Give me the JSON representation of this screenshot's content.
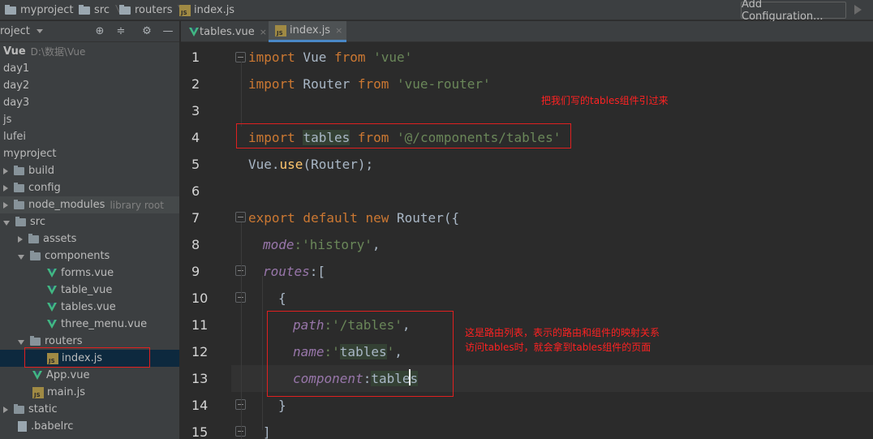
{
  "breadcrumb": {
    "items": [
      "myproject",
      "src",
      "routers",
      "index.js"
    ]
  },
  "toolbar": {
    "add_configuration": "Add Configuration..."
  },
  "project_panel": {
    "title": "roject",
    "tree": [
      {
        "label": "Vue",
        "extra": "D:\\数据\\Vue",
        "type": "root"
      },
      {
        "label": "day1",
        "type": "folder"
      },
      {
        "label": "day2",
        "type": "folder"
      },
      {
        "label": "day3",
        "type": "folder"
      },
      {
        "label": "js",
        "type": "folder"
      },
      {
        "label": "lufei",
        "type": "folder"
      },
      {
        "label": "myproject",
        "type": "folder"
      },
      {
        "label": "build",
        "type": "folder"
      },
      {
        "label": "config",
        "type": "folder"
      },
      {
        "label": "node_modules",
        "extra": "library root",
        "type": "folder"
      },
      {
        "label": "src",
        "type": "folder"
      },
      {
        "label": "assets",
        "type": "folder"
      },
      {
        "label": "components",
        "type": "folder"
      },
      {
        "label": "forms.vue",
        "type": "vue"
      },
      {
        "label": "table_vue",
        "type": "vue"
      },
      {
        "label": "tables.vue",
        "type": "vue"
      },
      {
        "label": "three_menu.vue",
        "type": "vue"
      },
      {
        "label": "routers",
        "type": "folder"
      },
      {
        "label": "index.js",
        "type": "js"
      },
      {
        "label": "App.vue",
        "type": "vue"
      },
      {
        "label": "main.js",
        "type": "js"
      },
      {
        "label": "static",
        "type": "folder"
      },
      {
        "label": ".babelrc",
        "type": "file"
      }
    ]
  },
  "tabs": [
    {
      "label": "tables.vue",
      "close": "×"
    },
    {
      "label": "index.js",
      "close": "×"
    }
  ],
  "editor": {
    "line_numbers": [
      "1",
      "2",
      "3",
      "4",
      "5",
      "6",
      "7",
      "8",
      "9",
      "10",
      "11",
      "12",
      "13",
      "14",
      "15"
    ],
    "code": {
      "l1_kw": "import",
      "l1_id": " Vue ",
      "l1_from": "from",
      "l1_str": " 'vue'",
      "l2_kw": "import",
      "l2_id": " Router ",
      "l2_from": "from",
      "l2_str": " 'vue-router'",
      "l4_kw": "import",
      "l4_id": "tables",
      "l4_from": "from",
      "l4_str": " '@/components/tables'",
      "l5_a": "Vue.",
      "l5_fn": "use",
      "l5_b": "(Router);",
      "l7_kw": "export default new",
      "l7_b": " Router({",
      "l8_prop": "mode",
      "l8_str": ":'history'",
      "l8_c": ",",
      "l9_prop": "routes",
      "l9_b": ":[",
      "l10": "{",
      "l11_prop": "path",
      "l11_str": ":'/tables'",
      "l11_c": ",",
      "l12_prop": "name",
      "l12_str": ":'",
      "l12_id": "tables",
      "l12_str2": "'",
      "l12_c": ",",
      "l13_prop": "component",
      "l13_b": ":",
      "l13_id": "tables",
      "l14": "}",
      "l15": "]"
    }
  },
  "annotations": {
    "note1": "把我们写的tables组件引过来",
    "note2_line1": "这是路由列表，表示的路由和组件的映射关系",
    "note2_line2": "访问tables时，就会拿到tables组件的页面"
  },
  "colors": {
    "annotation_red": "#e02020",
    "keyword": "#cc7832",
    "string": "#6a8759",
    "property": "#9876aa"
  }
}
